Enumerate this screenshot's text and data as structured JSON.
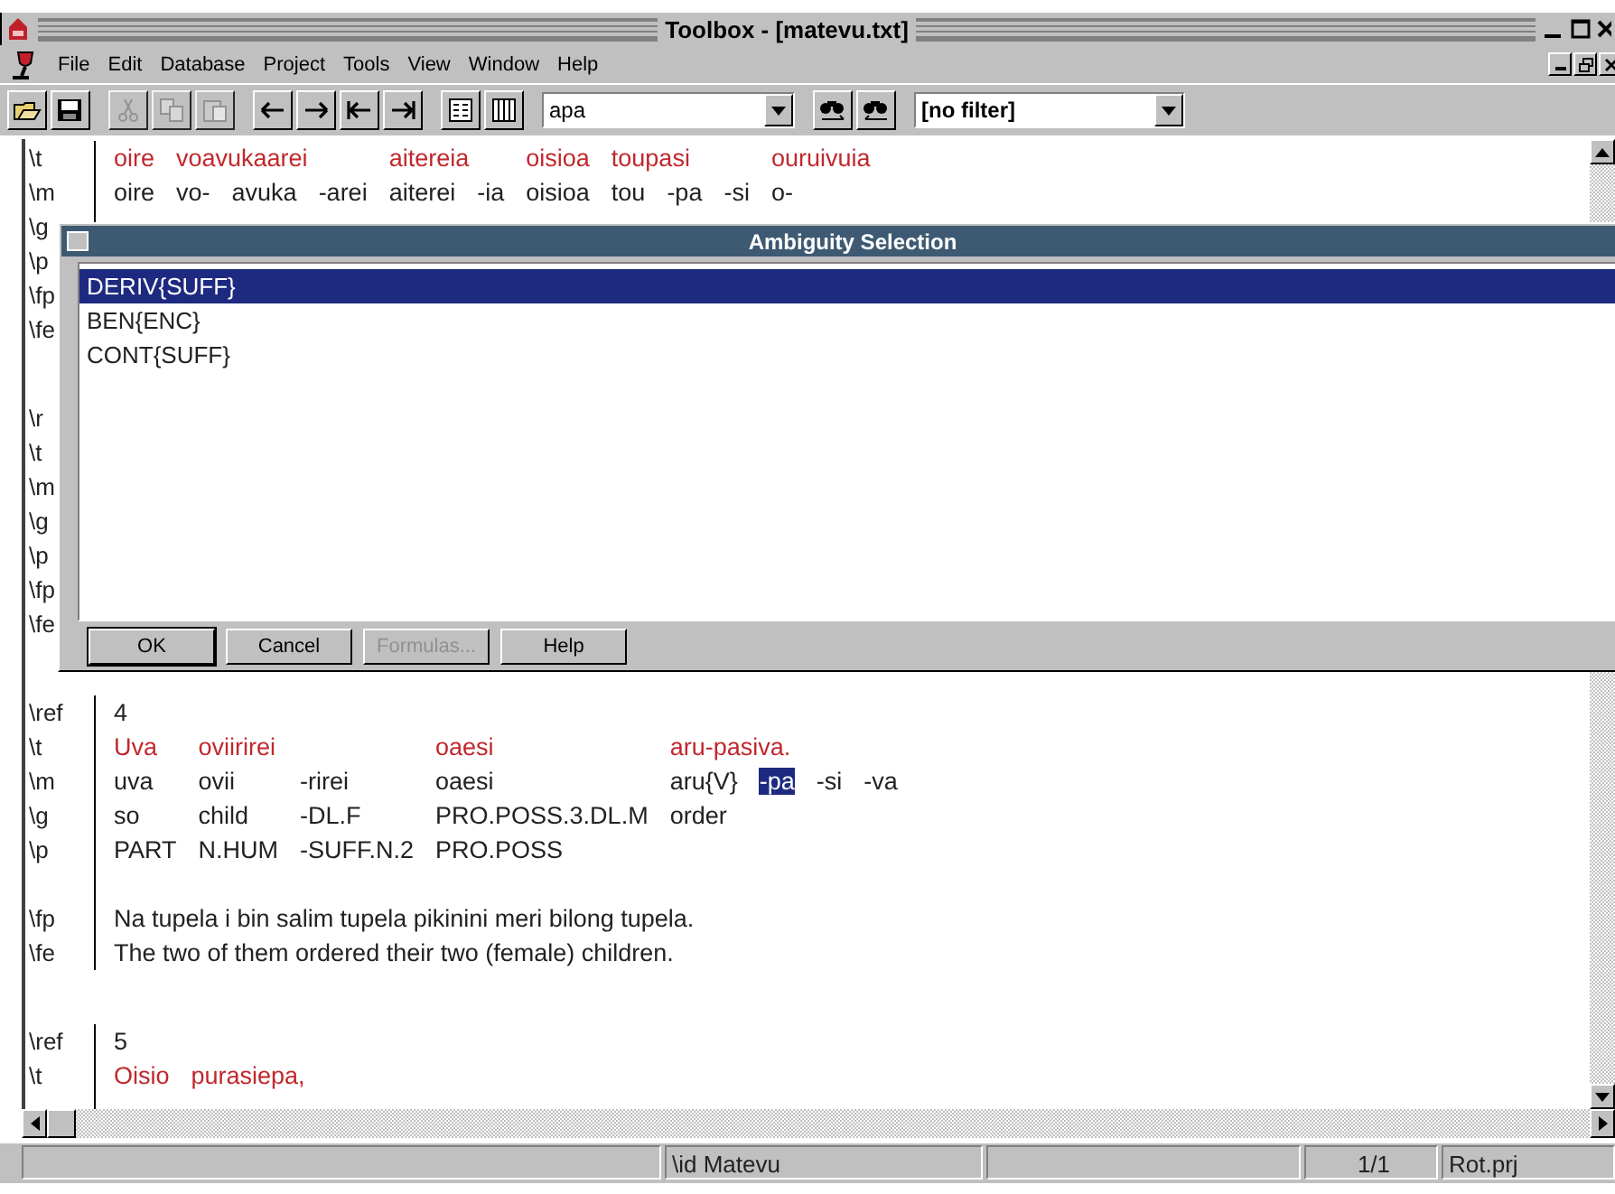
{
  "window": {
    "title": "Toolbox - [matevu.txt]"
  },
  "menu": [
    "File",
    "Edit",
    "Database",
    "Project",
    "Tools",
    "View",
    "Window",
    "Help"
  ],
  "toolbar": {
    "buttons": [
      {
        "kind": "open",
        "disabled": false
      },
      {
        "kind": "save",
        "disabled": false
      },
      {
        "kind": "sep"
      },
      {
        "kind": "cut",
        "disabled": true
      },
      {
        "kind": "copy",
        "disabled": true
      },
      {
        "kind": "paste",
        "disabled": true
      },
      {
        "kind": "sep"
      },
      {
        "kind": "prev",
        "disabled": false
      },
      {
        "kind": "next",
        "disabled": false
      },
      {
        "kind": "first",
        "disabled": false
      },
      {
        "kind": "last",
        "disabled": false
      },
      {
        "kind": "sep"
      },
      {
        "kind": "browse",
        "disabled": false
      },
      {
        "kind": "columns",
        "disabled": false
      }
    ],
    "search": {
      "value": "apa"
    },
    "find_buttons": [
      {
        "kind": "find-next"
      },
      {
        "kind": "find-prev"
      }
    ],
    "filter": {
      "value": "[no filter]"
    }
  },
  "records": [
    {
      "markers": [
        "\\t",
        "\\m",
        "\\g",
        "\\p",
        "\\fp",
        "\\fe"
      ],
      "words": [
        {
          "t": "oire",
          "morphs": [
            {
              "m": "oire"
            }
          ]
        },
        {
          "t": "voavukaarei",
          "morphs": [
            {
              "m": "vo-"
            },
            {
              "m": "avuka"
            },
            {
              "m": "-arei"
            }
          ]
        },
        {
          "t": "aitereia",
          "morphs": [
            {
              "m": "aiterei"
            },
            {
              "m": "-ia"
            }
          ]
        },
        {
          "t": "oisioa",
          "morphs": [
            {
              "m": "oisioa"
            }
          ]
        },
        {
          "t": "toupasi",
          "morphs": [
            {
              "m": "tou"
            },
            {
              "m": "-pa"
            },
            {
              "m": "-si"
            }
          ]
        },
        {
          "t": "ouruivuia",
          "morphs": [
            {
              "m": "o-"
            }
          ]
        }
      ]
    },
    {
      "markers": [
        "\\r",
        "\\t",
        "\\m",
        "\\g",
        "\\p",
        "\\fp",
        "\\fe"
      ]
    },
    {
      "markers": [
        "\\ref",
        "\\t",
        "\\m",
        "\\g",
        "\\p",
        "\\fp",
        "\\fe"
      ],
      "ref": "4",
      "words": [
        {
          "t": "Uva",
          "morphs": [
            {
              "m": "uva",
              "g": "so",
              "p": "PART",
              "selected": false
            }
          ]
        },
        {
          "t": "oviirirei",
          "morphs": [
            {
              "m": "ovii",
              "g": "child",
              "p": "N.HUM",
              "selected": false
            },
            {
              "m": "-rirei",
              "g": "-DL.F",
              "p": "-SUFF.N.2",
              "selected": false
            }
          ]
        },
        {
          "t": "oaesi",
          "morphs": [
            {
              "m": "oaesi",
              "g": "PRO.POSS.3.DL.M",
              "p": "PRO.POSS",
              "selected": false
            }
          ]
        },
        {
          "t": "aru-pasiva.",
          "morphs": [
            {
              "m": "aru{V}",
              "g": "order",
              "selected": false
            },
            {
              "m": "-pa",
              "selected": true
            },
            {
              "m": "-si",
              "selected": false
            },
            {
              "m": "-va",
              "selected": false
            }
          ]
        }
      ],
      "fp": "Na tupela i bin salim tupela pikinini meri bilong tupela.",
      "fe": "The two of them ordered their two (female) children."
    },
    {
      "markers": [
        "\\ref",
        "\\t"
      ],
      "ref": "5",
      "words": [
        {
          "t": "Oisio"
        },
        {
          "t": "purasiepa,"
        }
      ]
    }
  ],
  "dialog": {
    "title": "Ambiguity Selection",
    "options": [
      {
        "label": "DERIV{SUFF}",
        "selected": true
      },
      {
        "label": "BEN{ENC}",
        "selected": false
      },
      {
        "label": "CONT{SUFF}",
        "selected": false
      }
    ],
    "buttons": [
      {
        "label": "OK",
        "disabled": false,
        "default": true
      },
      {
        "label": "Cancel",
        "disabled": false,
        "default": false
      },
      {
        "label": "Formulas...",
        "disabled": true,
        "default": false
      },
      {
        "label": "Help",
        "disabled": false,
        "default": false
      }
    ]
  },
  "status_bar": [
    {
      "text": "\\id Matevu"
    },
    {
      "text": "1/1"
    },
    {
      "text": "Rot.prj"
    }
  ]
}
